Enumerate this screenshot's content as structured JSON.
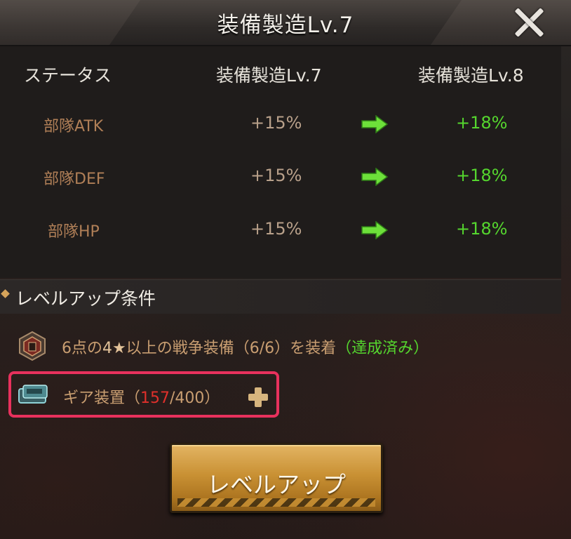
{
  "window": {
    "title": "装備製造Lv.7",
    "close_icon": "close-icon"
  },
  "table": {
    "headers": {
      "status": "ステータス",
      "current": "装備製造Lv.7",
      "next": "装備製造Lv.8"
    },
    "rows": [
      {
        "label": "部隊ATK",
        "current": "+15%",
        "next": "+18%"
      },
      {
        "label": "部隊DEF",
        "current": "+15%",
        "next": "+18%"
      },
      {
        "label": "部隊HP",
        "current": "+15%",
        "next": "+18%"
      }
    ]
  },
  "conditions": {
    "title": "レベルアップ条件",
    "items": [
      {
        "prefix": "6点の",
        "num": "4",
        "star": "★",
        "mid": "以上の戦争装備（6/6）を装着",
        "status": "（達成済み）"
      },
      {
        "label": "ギア装置（",
        "have": "157",
        "sep_need": "/400）"
      }
    ]
  },
  "button": {
    "label": "レベルアップ"
  },
  "colors": {
    "green": "#55d62e",
    "red": "#e0302b",
    "highlight": "#e8315d",
    "gold": "#c99134"
  }
}
